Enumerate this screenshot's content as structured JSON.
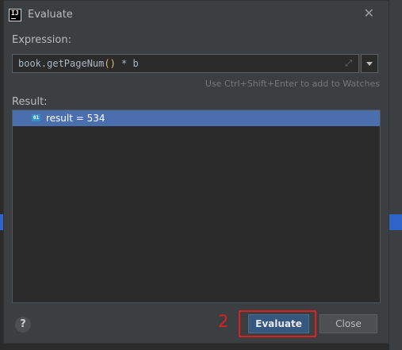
{
  "dialog": {
    "title": "Evaluate",
    "icon": "intellij-app-icon",
    "close_icon": "close-icon"
  },
  "expression": {
    "label": "Expression:",
    "code_before": "book.getPageNum",
    "code_parens": "()",
    "code_after": " * b",
    "hint": "Use Ctrl+Shift+Enter to add to Watches"
  },
  "result": {
    "label": "Result:",
    "items": [
      {
        "icon_text": "01",
        "text": "result = 534",
        "selected": true
      }
    ]
  },
  "annotation": {
    "step_number": "2",
    "color": "#e02020"
  },
  "buttons": {
    "help_label": "?",
    "evaluate_label": "Evaluate",
    "close_label": "Close"
  },
  "colors": {
    "dialog_bg": "#3c3f41",
    "field_bg": "#2b2b2b",
    "selection": "#4b6eaf",
    "default_button": "#365880"
  }
}
